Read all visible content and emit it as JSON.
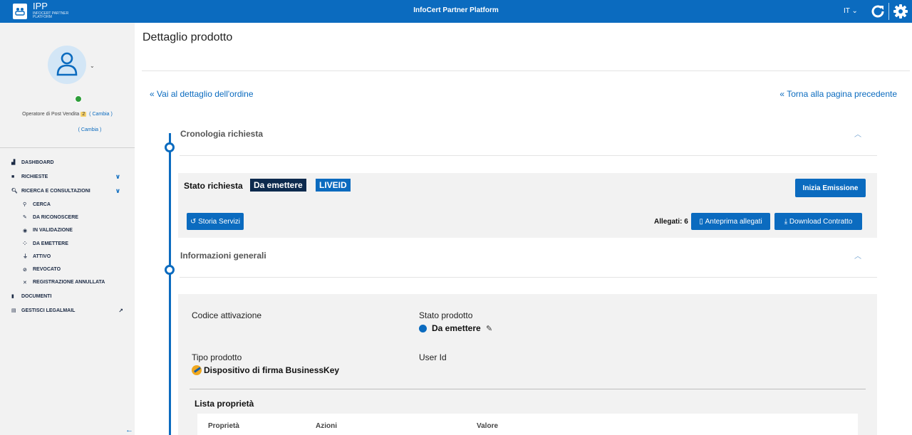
{
  "topbar": {
    "logo_text": "IPP",
    "logo_sub": "InfoCert Partner Platform",
    "title": "InfoCert Partner Platform",
    "lang": "IT"
  },
  "sidebar": {
    "role_label": "Operatore di Post Vendita",
    "role_count": "2",
    "change_link": "( Cambia )",
    "change_link2": "( Cambia )",
    "items": [
      {
        "label": "DASHBOARD",
        "icon": "dashboard-icon"
      },
      {
        "label": "RICHIESTE",
        "icon": "briefcase-icon"
      },
      {
        "label": "RICERCA E CONSULTAZIONI",
        "icon": "search-icon"
      },
      {
        "label": "CERCA",
        "icon": "search-icon"
      },
      {
        "label": "DA RICONOSCERE",
        "icon": "magic-icon"
      },
      {
        "label": "IN VALIDAZIONE",
        "icon": "eye-icon"
      },
      {
        "label": "DA EMETTERE",
        "icon": "spinner-icon"
      },
      {
        "label": "ATTIVO",
        "icon": "plug-icon"
      },
      {
        "label": "REVOCATO",
        "icon": "ban-icon"
      },
      {
        "label": "REGISTRAZIONE ANNULLATA",
        "icon": "times-icon"
      },
      {
        "label": "DOCUMENTI",
        "icon": "file-icon"
      },
      {
        "label": "GESTISCI LEGALMAIL",
        "icon": "mail-icon"
      }
    ]
  },
  "main": {
    "page_title": "Dettaglio prodotto",
    "back_link": "Vai al dettaglio dell'ordine",
    "prev_link": "Torna alla pagina precedente",
    "cronologia_title": "Cronologia richiesta",
    "stato_label": "Stato richiesta",
    "tag_state": "Da emettere",
    "tag_type": "LIVEID",
    "btn_emissione": "Inizia Emissione",
    "btn_storia": "Storia Servizi",
    "allegati_label": "Allegati: 6",
    "btn_anteprima": "Anteprima allegati",
    "btn_download": "Download Contratto",
    "info_title": "Informazioni generali",
    "codice_label": "Codice attivazione",
    "stato_prodotto_label": "Stato prodotto",
    "stato_prodotto_value": "Da emettere",
    "tipo_label": "Tipo prodotto",
    "tipo_value": "Dispositivo di firma BusinessKey",
    "userid_label": "User Id",
    "lista_title": "Lista proprietà",
    "table_headers": [
      "Proprietà",
      "Azioni",
      "Valore"
    ]
  },
  "colors": {
    "primary": "#0b6bbf",
    "dark_tag": "#0d2a4e",
    "status_green": "#2e9e3a",
    "badge_yellow": "#f5d06a"
  }
}
